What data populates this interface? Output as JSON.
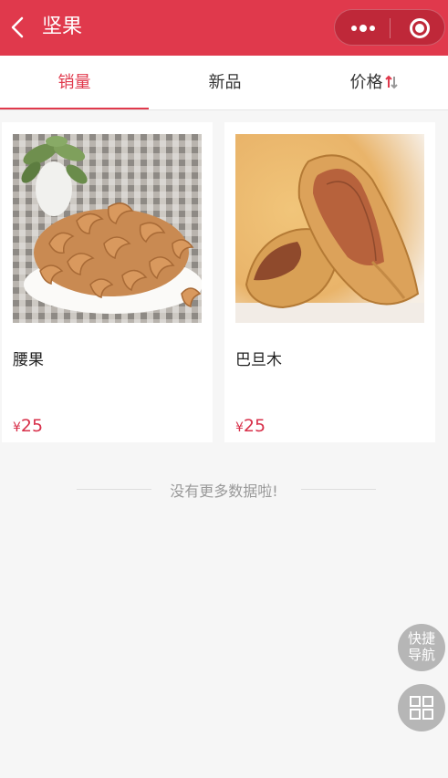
{
  "header": {
    "title": "坚果",
    "back_icon": "chevron-left-icon",
    "more_icon": "more-dots-icon",
    "close_icon": "target-circle-icon",
    "background_color": "#e0394c"
  },
  "tabs": [
    {
      "label": "销量",
      "active": true
    },
    {
      "label": "新品",
      "active": false
    },
    {
      "label": "价格",
      "active": false,
      "icon": "sort-updown-icon"
    }
  ],
  "products": [
    {
      "name": "腰果",
      "currency": "¥",
      "price": "25",
      "image": "cashew-photo"
    },
    {
      "name": "巴旦木",
      "currency": "¥",
      "price": "25",
      "image": "almond-photo"
    }
  ],
  "footer_note": "没有更多数据啦!",
  "floating": {
    "nav_line1": "快捷",
    "nav_line2": "导航",
    "grid_icon": "grid-icon"
  },
  "colors": {
    "accent": "#e0394c",
    "price": "#d8304a"
  }
}
